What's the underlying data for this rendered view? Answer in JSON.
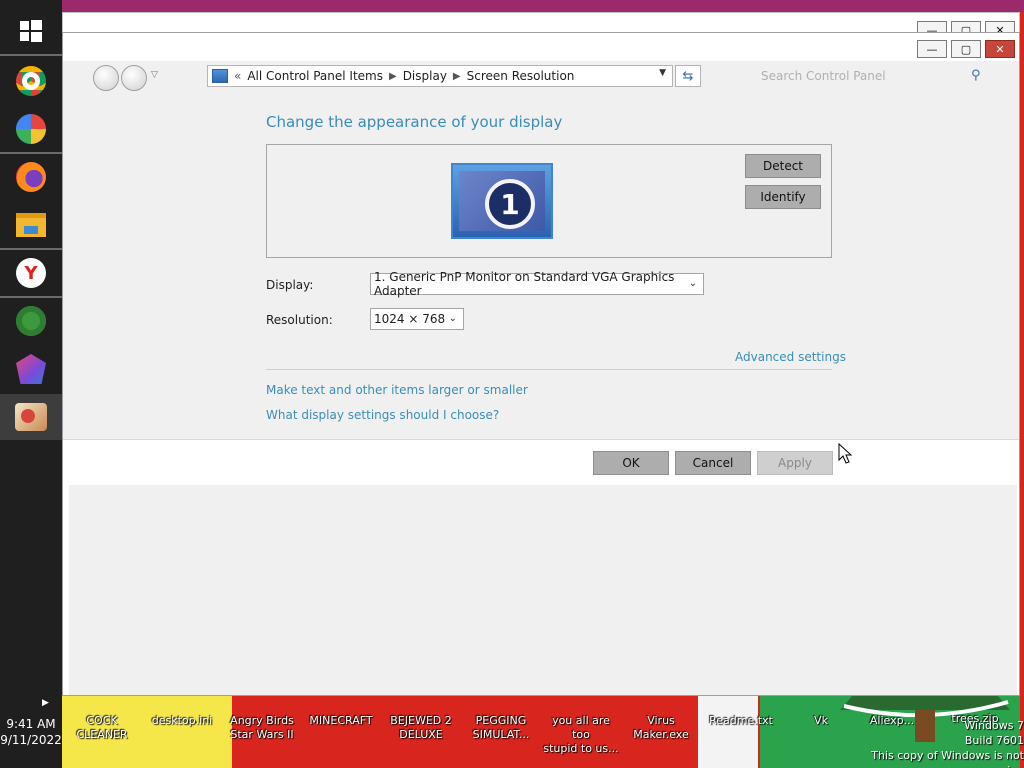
{
  "taskbar": {
    "clock_time": "9:41 AM",
    "clock_date": "9/11/2022",
    "apps": [
      {
        "icon": "windows-start-icon"
      },
      {
        "icon": "chrome-icon"
      },
      {
        "icon": "chromium-icon"
      },
      {
        "icon": "firefox-icon"
      },
      {
        "icon": "file-explorer-icon"
      },
      {
        "icon": "yandex-browser-icon"
      },
      {
        "icon": "ccleaner-icon"
      },
      {
        "icon": "polygon-app-icon"
      },
      {
        "icon": "active-app-icon"
      }
    ]
  },
  "window": {
    "address": {
      "history_glyph": "«",
      "crumbs": [
        "All Control Panel Items",
        "Display",
        "Screen Resolution"
      ]
    },
    "search_placeholder": "Search Control Panel",
    "page_title": "Change the appearance of your display",
    "monitor_number": "1",
    "detect_label": "Detect",
    "identify_label": "Identify",
    "display_label": "Display:",
    "display_value": "1. Generic PnP Monitor on Standard VGA Graphics Adapter",
    "resolution_label": "Resolution:",
    "resolution_value": "1024 × 768",
    "advanced_settings": "Advanced settings",
    "link_text_size": "Make text and other items larger or smaller",
    "link_which_settings": "What display settings should I choose?",
    "ok_label": "OK",
    "cancel_label": "Cancel",
    "apply_label": "Apply"
  },
  "desktop": {
    "icons": [
      "COCK\nCLEANER",
      "desktop.ini",
      "Angry Birds\nStar Wars II",
      "MINECRAFT",
      "BEJEWED 2\nDELUXE",
      "PEGGING\nSIMULAT...",
      "you all are too\nstupid to us...",
      "Virus\nMaker.exe",
      "Readme.txt",
      "Vk",
      "Aliexp...",
      "trees.zip"
    ],
    "watermark_line1": "Windows 7",
    "watermark_line2": "Build 7601",
    "watermark_line3": "This copy of Windows is not genuine"
  },
  "colors": {
    "accent_link": "#3a8db8",
    "taskbar": "#1f1f1f",
    "window_bg": "#f0f0f0",
    "button": "#adadad"
  }
}
